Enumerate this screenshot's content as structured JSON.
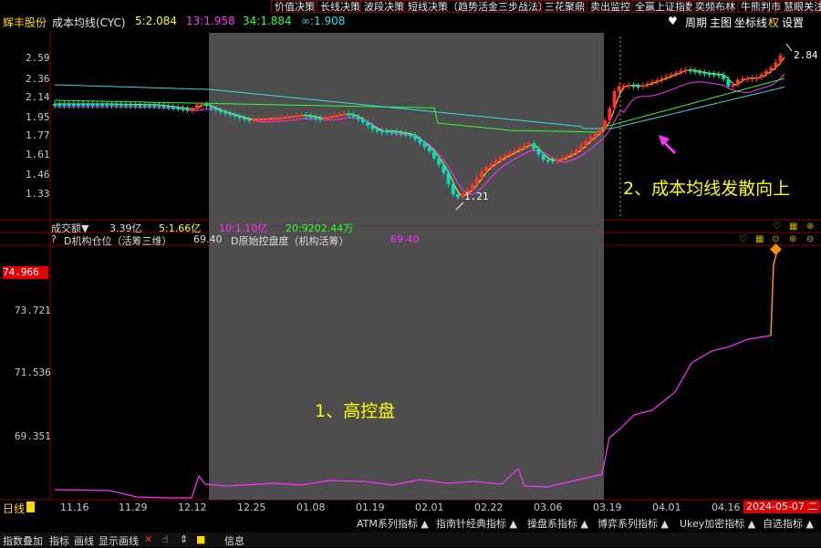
{
  "menu": [
    "价值决策",
    "长线决策",
    "波段决策",
    "短线决策（趋势活金三步战法）",
    "三花聚鼎",
    "卖出监控",
    "全赢上证指数",
    "奕频布林",
    "牛熊判市",
    "慧眼关注"
  ],
  "header": {
    "stock_name": "辉丰股份",
    "indicator": "成本均线(CYC)",
    "ma5": "5:2.084",
    "ma13": "13:1.958",
    "ma34": "34:1.884",
    "mainf": "∞:1.908",
    "right_items": [
      "周期",
      "主图",
      "坐标线",
      "权",
      "设置"
    ]
  },
  "price_axis": [
    "2.59",
    "2.36",
    "2.14",
    "1.95",
    "1.77",
    "1.61",
    "1.46",
    "1.33"
  ],
  "price_marks": {
    "low": "1.21",
    "high": "2.84"
  },
  "annotation2": "2、成本均线发散向上",
  "annotation1": "1、高控盘",
  "volume_header": {
    "label": "成交额▼",
    "value": "3.39亿",
    "ma5": "5:1.66亿",
    "ma10": "10:1.10亿",
    "ma20": "20:9202.44万"
  },
  "ind_header": {
    "name": "D机构仓位（活筹三维）",
    "value": "69.40",
    "name2": "D原始控盘度（机构活筹）",
    "value2": "69.40"
  },
  "ind_axis": {
    "current": "74.966",
    "a": "73.721",
    "b": "71.536",
    "c": "69.351"
  },
  "x_axis": [
    "11.16",
    "11.29",
    "12.12",
    "12.25",
    "01.08",
    "01.19",
    "02.01",
    "02.22",
    "03.06",
    "03.19",
    "04.01",
    "04.16"
  ],
  "period_label": "日线",
  "current_date": "2024-05-07 二",
  "bottom_tabs": [
    "ATM系列指标",
    "指南针经典指标",
    "操盘系指标",
    "博弈系列指标",
    "Ukey加密指标",
    "自选指标"
  ],
  "status_items": [
    "指数叠加",
    "指标",
    "画线",
    "显示画线",
    "信息"
  ],
  "colors": {
    "up": "#ff3030",
    "down": "#00e0c0",
    "ma5": "#ffff00",
    "ma13": "#ff30ff",
    "ma34": "#30ff30",
    "maInf": "#30e0e0",
    "ind": "#ff30ff",
    "ind_rise": "#ff8c00"
  }
}
